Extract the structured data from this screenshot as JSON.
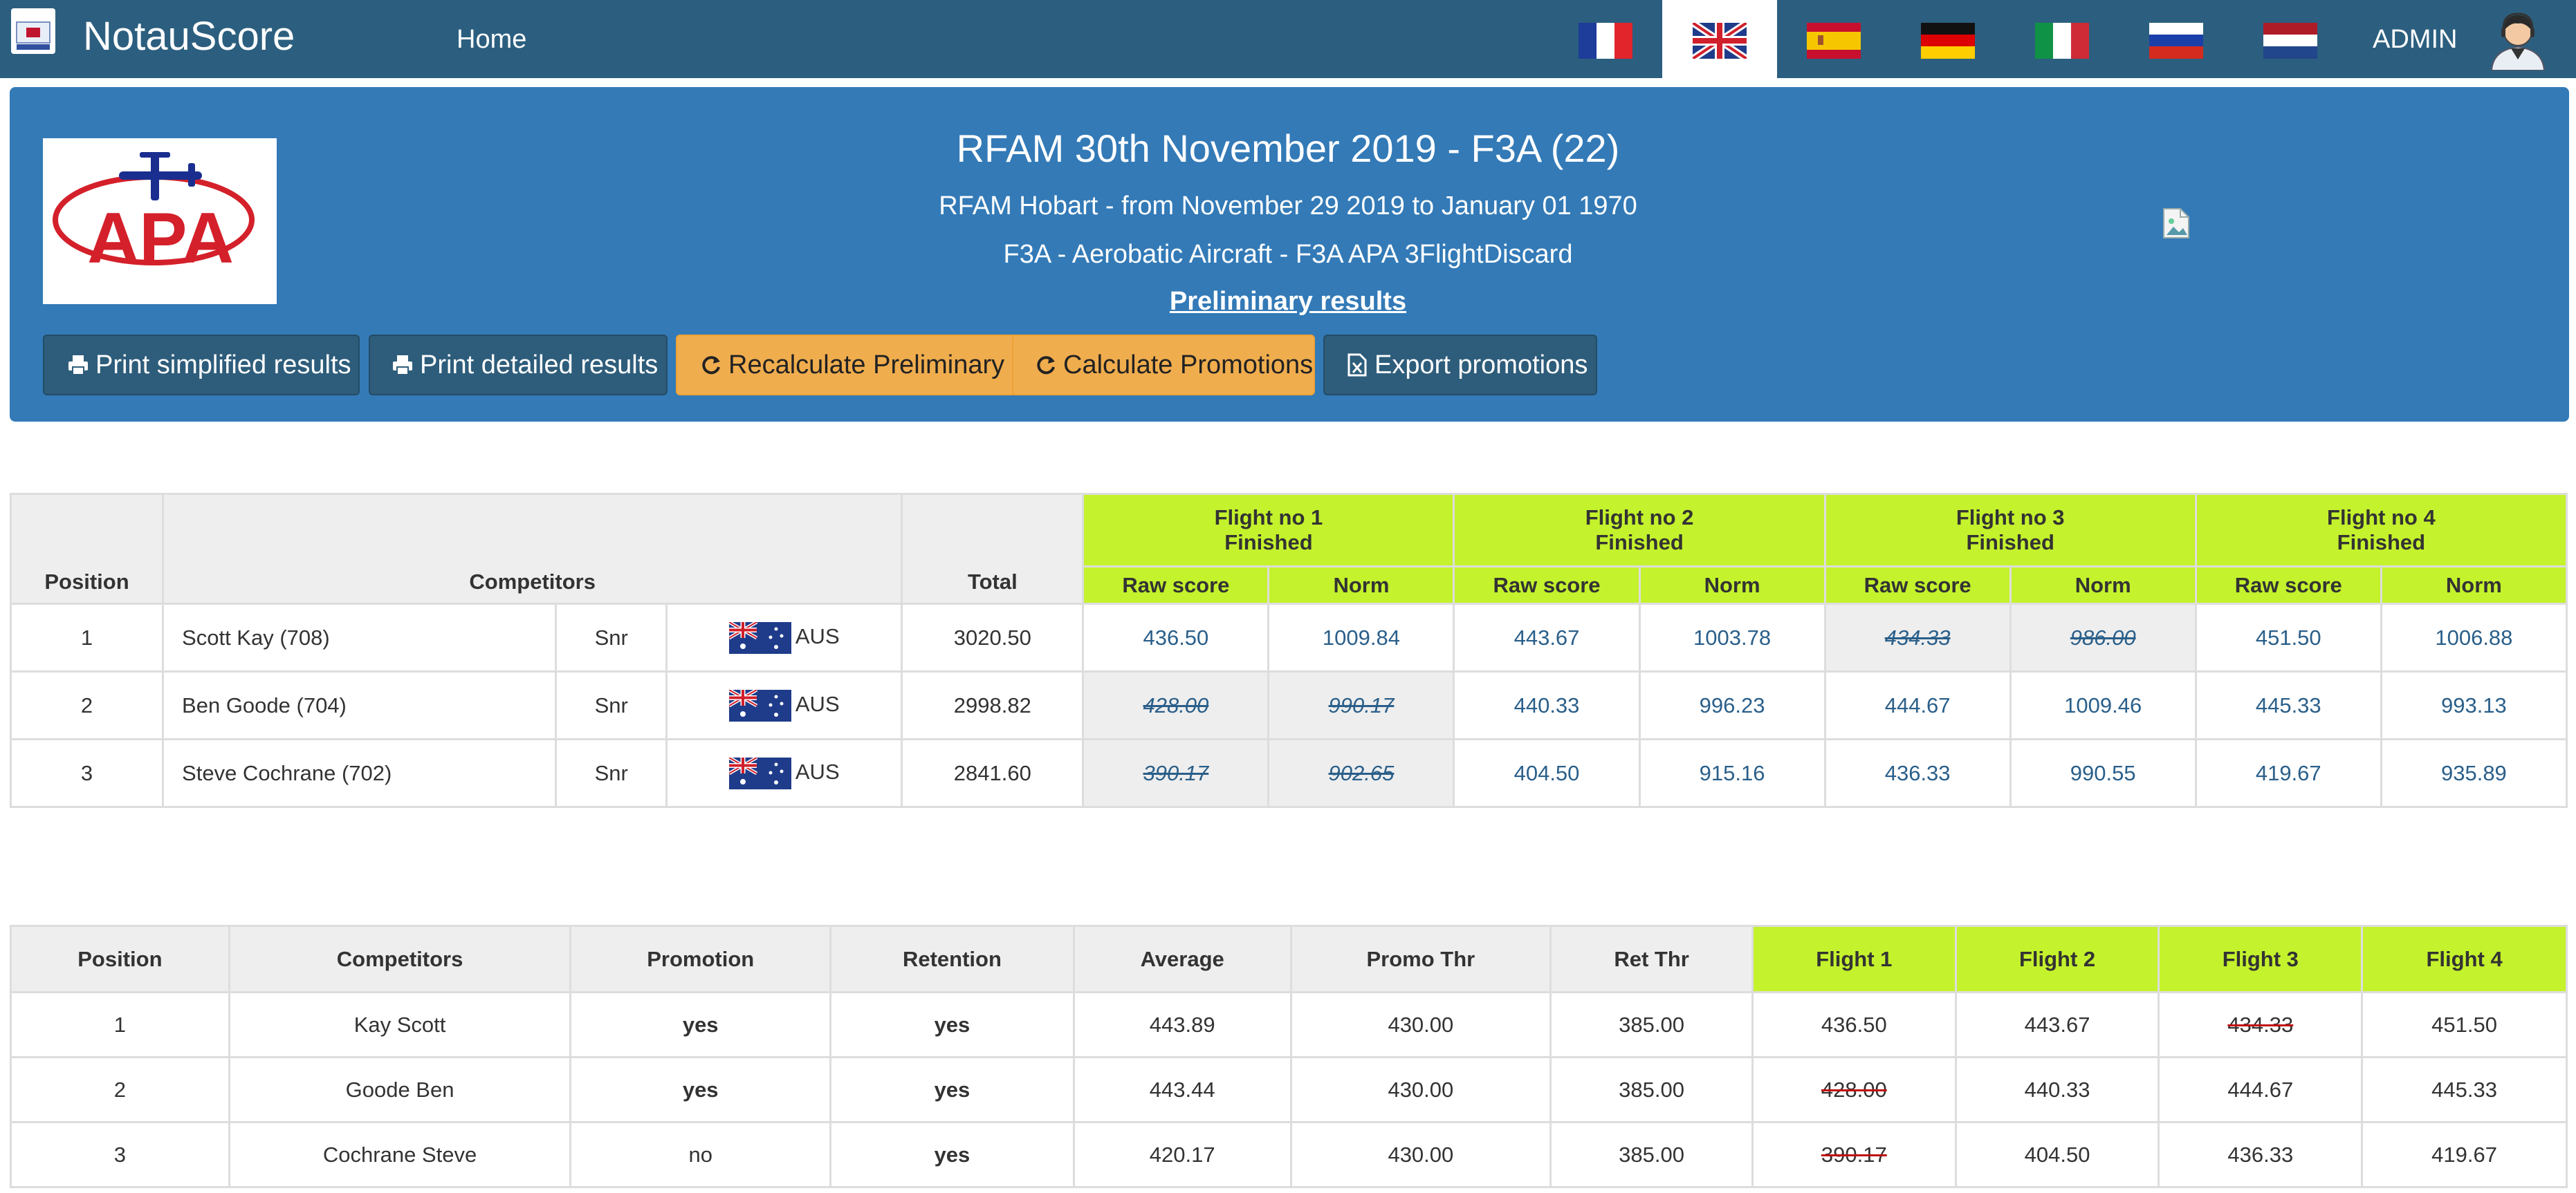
{
  "nav": {
    "brand": "NotauScore",
    "home": "Home",
    "admin": "ADMIN",
    "flags": [
      "flag-france",
      "flag-uk",
      "flag-spain",
      "flag-germany",
      "flag-italy",
      "flag-russia",
      "flag-netherlands"
    ],
    "active_flag": "flag-uk"
  },
  "header": {
    "title": "RFAM 30th November 2019 - F3A (22)",
    "subtitle": "RFAM Hobart - from November 29 2019 to January 01 1970",
    "category": "F3A - Aerobatic Aircraft - F3A APA 3FlightDiscard",
    "results_link": "Preliminary results",
    "logo_text": "APA",
    "buttons": {
      "print_simplified": "Print simplified results",
      "print_detailed": "Print detailed results",
      "recalculate": "Recalculate Preliminary",
      "calc_promotions": "Calculate Promotions",
      "export_promotions": "Export promotions"
    }
  },
  "results": {
    "headers": {
      "position": "Position",
      "competitors": "Competitors",
      "total": "Total",
      "raw": "Raw score",
      "norm": "Norm"
    },
    "flights": [
      {
        "name": "Flight no 1",
        "status": "Finished"
      },
      {
        "name": "Flight no 2",
        "status": "Finished"
      },
      {
        "name": "Flight no 3",
        "status": "Finished"
      },
      {
        "name": "Flight no 4",
        "status": "Finished"
      }
    ],
    "rows": [
      {
        "pos": "1",
        "name": "Scott Kay (708)",
        "class": "Snr",
        "country": "AUS",
        "total": "3020.50",
        "scores": [
          [
            "436.50",
            "1009.84"
          ],
          [
            "443.67",
            "1003.78"
          ],
          [
            "434.33",
            "986.00"
          ],
          [
            "451.50",
            "1006.88"
          ]
        ],
        "discarded": 2
      },
      {
        "pos": "2",
        "name": "Ben Goode (704)",
        "class": "Snr",
        "country": "AUS",
        "total": "2998.82",
        "scores": [
          [
            "428.00",
            "990.17"
          ],
          [
            "440.33",
            "996.23"
          ],
          [
            "444.67",
            "1009.46"
          ],
          [
            "445.33",
            "993.13"
          ]
        ],
        "discarded": 0
      },
      {
        "pos": "3",
        "name": "Steve Cochrane (702)",
        "class": "Snr",
        "country": "AUS",
        "total": "2841.60",
        "scores": [
          [
            "390.17",
            "902.65"
          ],
          [
            "404.50",
            "915.16"
          ],
          [
            "436.33",
            "990.55"
          ],
          [
            "419.67",
            "935.89"
          ]
        ],
        "discarded": 0
      }
    ]
  },
  "promotions": {
    "headers": [
      "Position",
      "Competitors",
      "Promotion",
      "Retention",
      "Average",
      "Promo Thr",
      "Ret Thr",
      "Flight 1",
      "Flight 2",
      "Flight 3",
      "Flight 4"
    ],
    "rows": [
      {
        "pos": "1",
        "name": "Kay Scott",
        "promotion": "yes",
        "retention": "yes",
        "average": "443.89",
        "promo_thr": "430.00",
        "ret_thr": "385.00",
        "flights": [
          "436.50",
          "443.67",
          "434.33",
          "451.50"
        ],
        "discarded": 2
      },
      {
        "pos": "2",
        "name": "Goode Ben",
        "promotion": "yes",
        "retention": "yes",
        "average": "443.44",
        "promo_thr": "430.00",
        "ret_thr": "385.00",
        "flights": [
          "428.00",
          "440.33",
          "444.67",
          "445.33"
        ],
        "discarded": 0
      },
      {
        "pos": "3",
        "name": "Cochrane Steve",
        "promotion": "no",
        "retention": "yes",
        "average": "420.17",
        "promo_thr": "430.00",
        "ret_thr": "385.00",
        "flights": [
          "390.17",
          "404.50",
          "436.33",
          "419.67"
        ],
        "discarded": 0
      }
    ]
  },
  "colors": {
    "navbar": "#2c5f7f",
    "panel": "#337ab7",
    "flight_header": "#c4f22c",
    "warning_button": "#f0ad4e"
  }
}
